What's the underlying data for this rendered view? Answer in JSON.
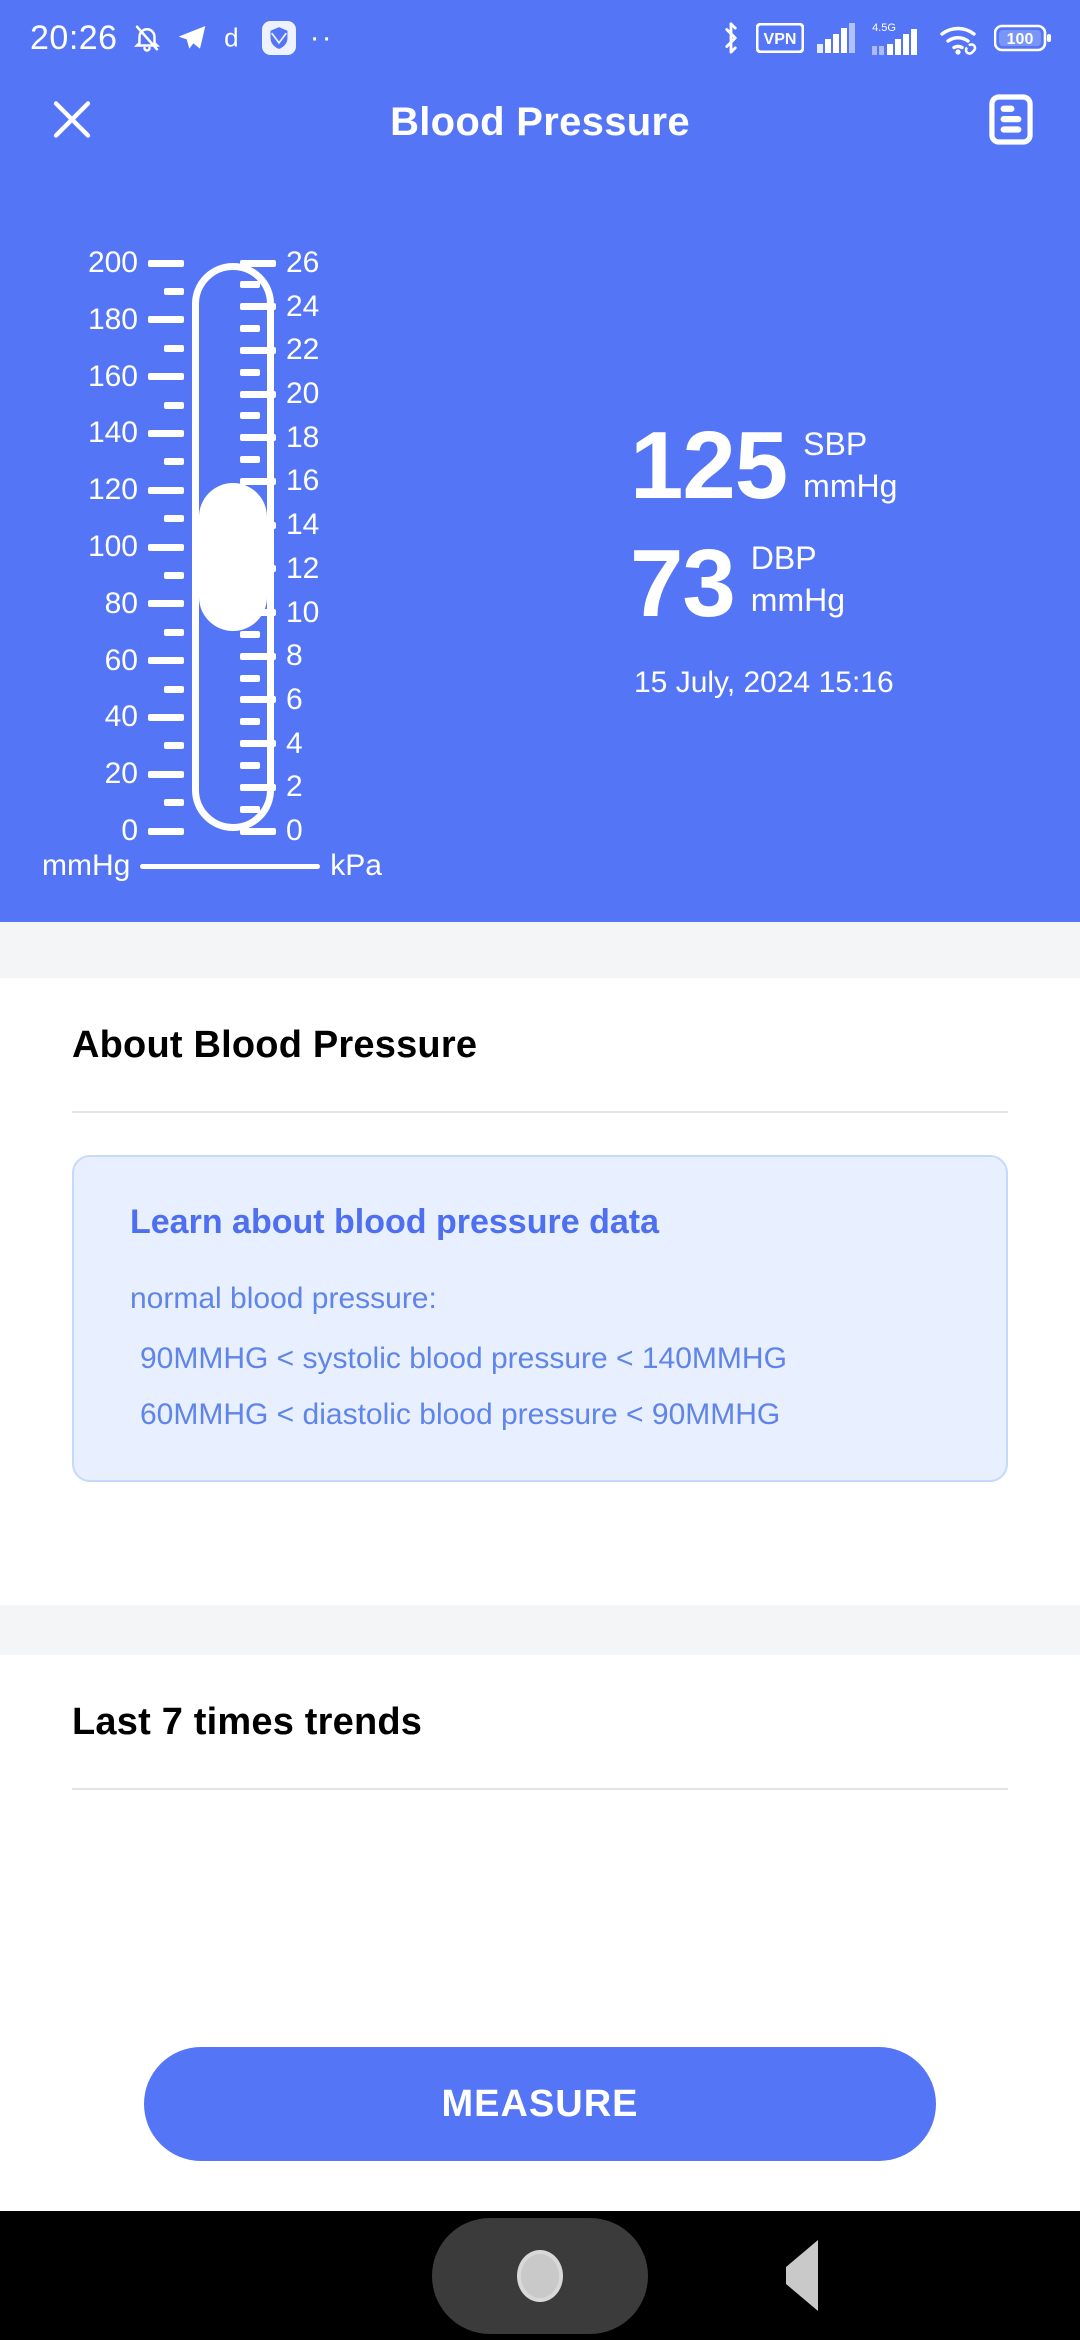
{
  "status_bar": {
    "time": "20:26",
    "left_icons": [
      "mute-bell-icon",
      "telegram-icon",
      "dictionary-d-icon",
      "shield-app-icon",
      "more-dots-icon"
    ],
    "right_icons": [
      "bluetooth-icon",
      "vpn-icon",
      "signal-bars-icon",
      "signal-bars-2-icon",
      "wifi-icon",
      "battery-icon"
    ],
    "vpn_label": "VPN",
    "network_label": "4.5G",
    "battery_level": "100"
  },
  "app_bar": {
    "close_label": "close-icon",
    "title": "Blood Pressure",
    "menu_label": "records-icon"
  },
  "gauge": {
    "left_unit": "mmHg",
    "right_unit": "kPa",
    "left_min": 0,
    "left_max": 200,
    "left_major_step": 20,
    "left_labels": [
      "200",
      "180",
      "160",
      "140",
      "120",
      "100",
      "80",
      "60",
      "40",
      "20",
      "0"
    ],
    "right_min": 0,
    "right_max": 26,
    "right_major_step": 2,
    "right_labels": [
      "26",
      "24",
      "22",
      "20",
      "18",
      "16",
      "14",
      "12",
      "10",
      "8",
      "6",
      "4",
      "2",
      "0"
    ],
    "fill_low": 73,
    "fill_high": 125,
    "fill_color": "#ffffff",
    "track_color": "#5575f7"
  },
  "readings": {
    "systolic": {
      "value": "125",
      "key": "SBP",
      "unit": "mmHg"
    },
    "diastolic": {
      "value": "73",
      "key": "DBP",
      "unit": "mmHg"
    },
    "timestamp": "15 July, 2024 15:16"
  },
  "about_section": {
    "title": "About Blood Pressure",
    "card": {
      "title": "Learn about blood pressure data",
      "subtitle": "normal blood pressure:",
      "lines": [
        "90MMHG < systolic blood pressure < 140MMHG",
        "60MMHG < diastolic blood pressure < 90MMHG"
      ]
    }
  },
  "trends_section": {
    "title": "Last 7 times trends"
  },
  "measure_button": {
    "label": "MEASURE"
  },
  "nav_bar": {
    "recent_label": "recent-apps-icon",
    "home_label": "home-icon",
    "back_label": "back-icon"
  },
  "colors": {
    "brand_blue": "#5575f7",
    "card_bg": "#e8efff",
    "card_border": "#c7d9fb",
    "card_text": "#5f84ea",
    "card_title": "#4d6ff0",
    "spacer_gray": "#f4f5f6"
  }
}
